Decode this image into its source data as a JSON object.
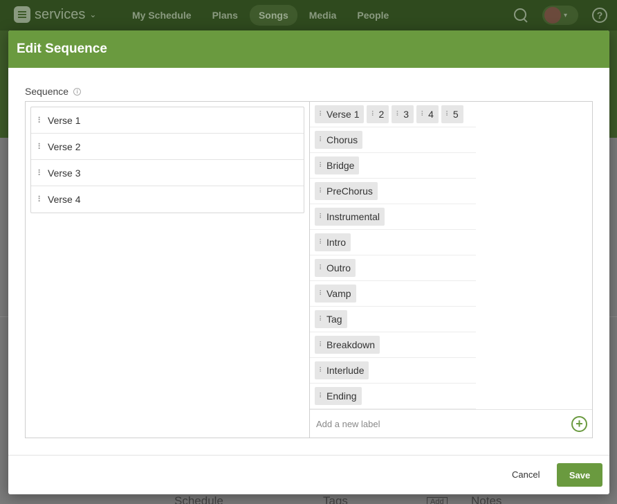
{
  "app": {
    "name": "services"
  },
  "nav": {
    "items": [
      "My Schedule",
      "Plans",
      "Songs",
      "Media",
      "People"
    ],
    "active": "Songs"
  },
  "background": {
    "schedule_label": "Schedule",
    "tags_label": "Tags",
    "add_label": "Add",
    "notes_label": "Notes"
  },
  "modal": {
    "title": "Edit Sequence",
    "sequence_label": "Sequence",
    "sequence_items": [
      "Verse 1",
      "Verse 2",
      "Verse 3",
      "Verse 4"
    ],
    "verse_row": {
      "first": "Verse 1",
      "numbers": [
        "2",
        "3",
        "4",
        "5"
      ]
    },
    "labels": [
      "Chorus",
      "Bridge",
      "PreChorus",
      "Instrumental",
      "Intro",
      "Outro",
      "Vamp",
      "Tag",
      "Breakdown",
      "Interlude",
      "Ending"
    ],
    "add_placeholder": "Add a new label",
    "cancel_label": "Cancel",
    "save_label": "Save"
  },
  "colors": {
    "accent": "#6a9a3f",
    "chip_bg": "#e6e6e6"
  }
}
